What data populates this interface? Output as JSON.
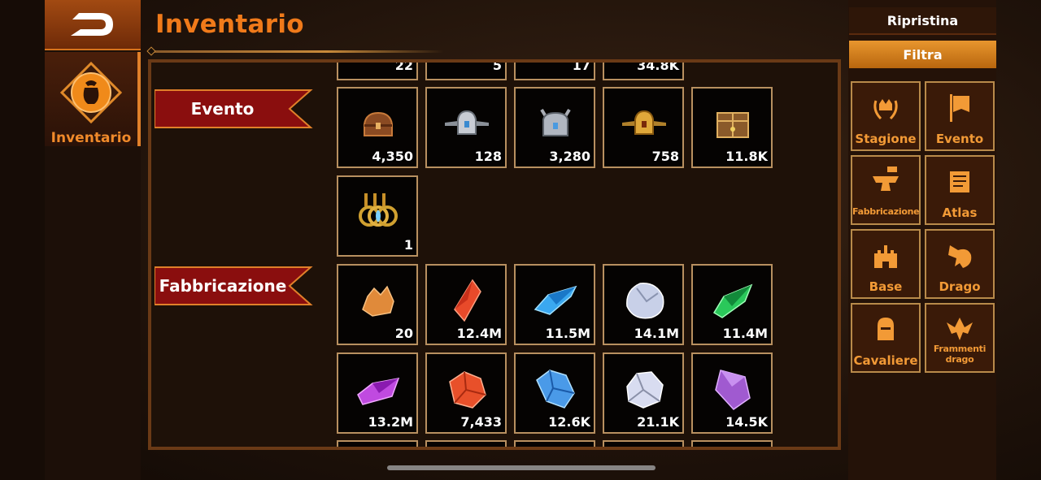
{
  "header": {
    "title": "Inventario"
  },
  "nav": {
    "back_icon": "back-arrow-icon",
    "active_tab_label": "Inventario",
    "active_tab_icon": "bag-icon"
  },
  "sections": [
    {
      "label": "Evento"
    },
    {
      "label": "Fabbricazione"
    }
  ],
  "top_row_partial": [
    "22",
    "5",
    "17",
    "34.8K"
  ],
  "evento_items": [
    {
      "icon": "brown-chest-icon",
      "qty": "4,350"
    },
    {
      "icon": "silver-winged-chest-icon",
      "qty": "128"
    },
    {
      "icon": "silver-spiked-chest-icon",
      "qty": "3,280"
    },
    {
      "icon": "gold-winged-chest-icon",
      "qty": "758"
    },
    {
      "icon": "treasure-crate-icon",
      "qty": "11.8K"
    },
    {
      "icon": "gold-rings-icon",
      "qty": "1"
    }
  ],
  "fabbricazione_items": [
    {
      "icon": "gold-ore-icon",
      "qty": "20",
      "color": "#e08a3a"
    },
    {
      "icon": "red-crystal-icon",
      "qty": "12.4M",
      "color": "#e84a2a"
    },
    {
      "icon": "blue-crystal-icon",
      "qty": "11.5M",
      "color": "#3aa8f0"
    },
    {
      "icon": "white-crystal-icon",
      "qty": "14.1M",
      "color": "#c8d0e8"
    },
    {
      "icon": "green-crystal-icon",
      "qty": "11.4M",
      "color": "#2ac85a"
    },
    {
      "icon": "purple-crystal-icon",
      "qty": "13.2M",
      "color": "#c04ae0"
    },
    {
      "icon": "red-ore-icon",
      "qty": "7,433",
      "color": "#e8502a"
    },
    {
      "icon": "blue-ore-icon",
      "qty": "12.6K",
      "color": "#4a9ae8"
    },
    {
      "icon": "silver-ore-icon",
      "qty": "21.1K",
      "color": "#d8dcf0"
    },
    {
      "icon": "violet-crystal-icon",
      "qty": "14.5K",
      "color": "#a05ad0"
    }
  ],
  "right_panel": {
    "reset_label": "Ripristina",
    "filter_label": "Filtra",
    "filters": [
      {
        "label": "Stagione",
        "icon": "laurel-crown-icon"
      },
      {
        "label": "Evento",
        "icon": "banner-icon"
      },
      {
        "label": "Fabbricazione",
        "icon": "anvil-icon"
      },
      {
        "label": "Atlas",
        "icon": "map-scroll-icon"
      },
      {
        "label": "Base",
        "icon": "castle-icon"
      },
      {
        "label": "Drago",
        "icon": "dragon-head-icon"
      },
      {
        "label": "Cavaliere",
        "icon": "knight-helmet-icon"
      },
      {
        "label": "Frammenti drago",
        "icon": "dragon-fragment-icon"
      }
    ]
  },
  "colors": {
    "accent": "#f07a1a",
    "panel_border": "#6a3a16",
    "slot_border": "#b89060",
    "ribbon": "#9a1010"
  }
}
